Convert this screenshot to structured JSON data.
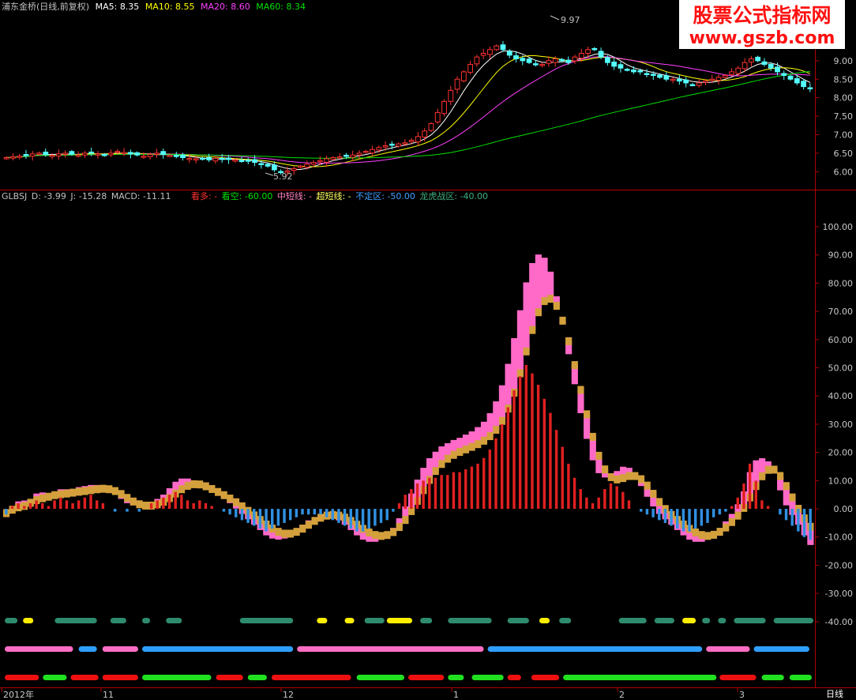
{
  "watermark": {
    "line1": "股票公式指标网",
    "line2": "www.gszb.com"
  },
  "price_panel": {
    "stock": "浦东金桥",
    "period_note": "(日线,前复权)",
    "ma_labels": [
      {
        "name": "MA5",
        "value": "8.35",
        "color": "#ffffff"
      },
      {
        "name": "MA10",
        "value": "8.55",
        "color": "#ffff00"
      },
      {
        "name": "MA20",
        "value": "8.60",
        "color": "#ff40ff"
      },
      {
        "name": "MA60",
        "value": "8.34",
        "color": "#00e000"
      }
    ],
    "high_mark": "9.97",
    "low_mark": "5.92",
    "y_ticks": [
      "9.00",
      "8.50",
      "8.00",
      "7.50",
      "7.00",
      "6.50",
      "6.00"
    ]
  },
  "indicator_panel": {
    "name": "GLBSJ",
    "values": [
      {
        "name": "D",
        "value": "-3.99",
        "color": "#c0c0c0"
      },
      {
        "name": "J",
        "value": "-15.28",
        "color": "#c0c0c0"
      },
      {
        "name": "MACD",
        "value": "-11.11",
        "color": "#c0c0c0"
      },
      {
        "name": "看多",
        "value": "-",
        "color": "#ff3030"
      },
      {
        "name": "看空",
        "value": "-60.00",
        "color": "#00e000"
      },
      {
        "name": "中短线",
        "value": "-",
        "color": "#ff80c0"
      },
      {
        "name": "超短线",
        "value": "-",
        "color": "#ffff60"
      },
      {
        "name": "不定区",
        "value": "-50.00",
        "color": "#40a0ff"
      },
      {
        "name": "龙虎战区",
        "value": "-40.00",
        "color": "#40b080"
      }
    ],
    "y_ticks": [
      "100.00",
      "90.00",
      "80.00",
      "70.00",
      "60.00",
      "50.00",
      "40.00",
      "30.00",
      "20.00",
      "10.00",
      "0.00",
      "-10.00",
      "-20.00",
      "-30.00",
      "-40.00"
    ]
  },
  "x_axis": {
    "labels": [
      "2012年",
      "11",
      "12",
      "1",
      "2",
      "3"
    ],
    "period_button": "日线"
  },
  "colors": {
    "up_candle": "#ff3232",
    "down_candle": "#54ffff",
    "frame": "#b00000",
    "kdj_band": "#ff69c8",
    "k_band": "#d4a03c",
    "macd_pos": "#e02020",
    "macd_neg": "#3090e0",
    "strip_teal": "#2e8b6e",
    "strip_yellow": "#ffee00",
    "strip_pink": "#ff6ec4",
    "strip_blue": "#2f9fff",
    "strip_red": "#ee1010",
    "strip_green": "#20e020"
  },
  "chart_data": [
    {
      "type": "candlestick",
      "title": "浦东金桥 (日线,前复权)",
      "y_range": [
        5.6,
        10.3
      ],
      "annotations": [
        {
          "label": "9.97"
        },
        {
          "label": "5.92"
        }
      ],
      "series": [
        {
          "name": "MA5",
          "value": 8.35
        },
        {
          "name": "MA10",
          "value": 8.55
        },
        {
          "name": "MA20",
          "value": 8.6
        },
        {
          "name": "MA60",
          "value": 8.34
        }
      ],
      "close": [
        6.38,
        6.4,
        6.42,
        6.45,
        6.48,
        6.5,
        6.46,
        6.44,
        6.48,
        6.5,
        6.47,
        6.45,
        6.5,
        6.52,
        6.48,
        6.44,
        6.5,
        6.55,
        6.52,
        6.48,
        6.45,
        6.42,
        6.46,
        6.5,
        6.47,
        6.44,
        6.42,
        6.38,
        6.36,
        6.35,
        6.34,
        6.32,
        6.36,
        6.34,
        6.33,
        6.32,
        6.3,
        6.28,
        6.25,
        6.2,
        6.15,
        6.05,
        6.0,
        6.02,
        6.08,
        6.15,
        6.2,
        6.25,
        6.3,
        6.35,
        6.38,
        6.4,
        6.42,
        6.45,
        6.5,
        6.55,
        6.6,
        6.65,
        6.7,
        6.72,
        6.75,
        6.78,
        6.85,
        6.95,
        7.1,
        7.3,
        7.6,
        7.9,
        8.2,
        8.5,
        8.7,
        8.9,
        9.1,
        9.2,
        9.3,
        9.4,
        9.3,
        9.15,
        9.05,
        9.0,
        8.95,
        8.9,
        8.9,
        9.0,
        9.05,
        9.0,
        8.95,
        9.1,
        9.2,
        9.3,
        9.3,
        9.1,
        8.95,
        8.85,
        8.8,
        8.75,
        8.7,
        8.7,
        8.65,
        8.6,
        8.55,
        8.5,
        8.5,
        8.45,
        8.4,
        8.35,
        8.4,
        8.45,
        8.5,
        8.55,
        8.6,
        8.7,
        8.8,
        8.95,
        9.05,
        9.0,
        8.9,
        8.8,
        8.7,
        8.6,
        8.5,
        8.4,
        8.3,
        8.25
      ]
    },
    {
      "type": "bar",
      "title": "GLBSJ",
      "y_range": [
        -42,
        107
      ],
      "series": [
        {
          "name": "D",
          "value": -3.99
        },
        {
          "name": "J",
          "value": -15.28
        },
        {
          "name": "MACD",
          "value": -11.11
        },
        {
          "name": "看空",
          "value": -60.0
        },
        {
          "name": "不定区",
          "value": -50.0
        },
        {
          "name": "龙虎战区",
          "value": -40.0
        }
      ],
      "macd": [
        -2,
        1,
        2,
        1,
        2,
        3,
        2,
        1,
        3,
        4,
        3,
        2,
        3,
        4,
        5,
        3,
        2,
        0,
        -1,
        0,
        -1,
        0,
        -1,
        0,
        2,
        3,
        4,
        5,
        6,
        5,
        3,
        2,
        3,
        2,
        1,
        0,
        -1,
        -2,
        -3,
        -4,
        -5,
        -6,
        -7,
        -8,
        -7,
        -6,
        -5,
        -4,
        -3,
        -2,
        -2,
        -2,
        -2,
        -3,
        -4,
        -5,
        -6,
        -7,
        -8,
        -8,
        -7,
        -6,
        -5,
        -4,
        -1,
        2,
        5,
        7,
        9,
        10,
        11,
        11,
        12,
        12,
        13,
        13,
        14,
        15,
        16,
        18,
        21,
        25,
        30,
        36,
        42,
        47,
        51,
        48,
        44,
        39,
        34,
        28,
        22,
        16,
        11,
        7,
        4,
        2,
        4,
        7,
        9,
        8,
        6,
        3,
        0,
        -1,
        -2,
        -3,
        -4,
        -5,
        -6,
        -7,
        -8,
        -8,
        -7,
        -6,
        -5,
        -3,
        -2,
        -1,
        1,
        4,
        9,
        16,
        10,
        3,
        1,
        0,
        -2,
        -4,
        -6,
        -8,
        -10,
        -11
      ]
    }
  ],
  "signal_strips": [
    {
      "segments": [
        [
          0.2,
          1.8,
          "teal"
        ],
        [
          2.5,
          3.8,
          "yellow"
        ],
        [
          6.5,
          11.8,
          "teal"
        ],
        [
          13.5,
          15.5,
          "teal"
        ],
        [
          17.5,
          18.5,
          "teal"
        ],
        [
          20.5,
          22.5,
          "teal"
        ],
        [
          29.8,
          36.5,
          "teal"
        ],
        [
          39.5,
          40.8,
          "yellow"
        ],
        [
          43,
          44.2,
          "yellow"
        ],
        [
          45.5,
          48,
          "teal"
        ],
        [
          48.3,
          51.5,
          "yellow"
        ],
        [
          52.5,
          54,
          "teal"
        ],
        [
          56,
          61.5,
          "teal"
        ],
        [
          63.5,
          66.2,
          "teal"
        ],
        [
          67.5,
          68.8,
          "yellow"
        ],
        [
          70,
          71.5,
          "teal"
        ],
        [
          77.5,
          81,
          "teal"
        ],
        [
          82,
          84.5,
          "teal"
        ],
        [
          85.5,
          87.2,
          "yellow"
        ],
        [
          88,
          89,
          "teal"
        ],
        [
          90,
          91,
          "teal"
        ],
        [
          92,
          96,
          "teal"
        ],
        [
          97,
          102,
          "teal"
        ]
      ]
    },
    {
      "segments": [
        [
          0.2,
          8.8,
          "pink"
        ],
        [
          9.5,
          11.8,
          "blue"
        ],
        [
          12.5,
          17,
          "pink"
        ],
        [
          17.5,
          36.5,
          "blue"
        ],
        [
          37,
          60.5,
          "pink"
        ],
        [
          61,
          88,
          "blue"
        ],
        [
          88.5,
          94,
          "pink"
        ],
        [
          94.5,
          101.5,
          "blue"
        ]
      ]
    },
    {
      "segments": [
        [
          0.2,
          4.5,
          "red"
        ],
        [
          5,
          8,
          "green"
        ],
        [
          8.5,
          12,
          "red"
        ],
        [
          12.5,
          17,
          "red"
        ],
        [
          17.5,
          26.2,
          "green"
        ],
        [
          26.8,
          30.2,
          "red"
        ],
        [
          30.8,
          33.2,
          "green"
        ],
        [
          33.8,
          43.8,
          "red"
        ],
        [
          44.5,
          50.5,
          "green"
        ],
        [
          51,
          55.5,
          "red"
        ],
        [
          56,
          58,
          "green"
        ],
        [
          59,
          63,
          "green"
        ],
        [
          63.5,
          65.2,
          "red"
        ],
        [
          66.5,
          70,
          "red"
        ],
        [
          70.5,
          89.8,
          "green"
        ],
        [
          90.2,
          94.8,
          "red"
        ],
        [
          95.5,
          98.3,
          "green"
        ],
        [
          99,
          101.8,
          "green"
        ]
      ]
    }
  ]
}
